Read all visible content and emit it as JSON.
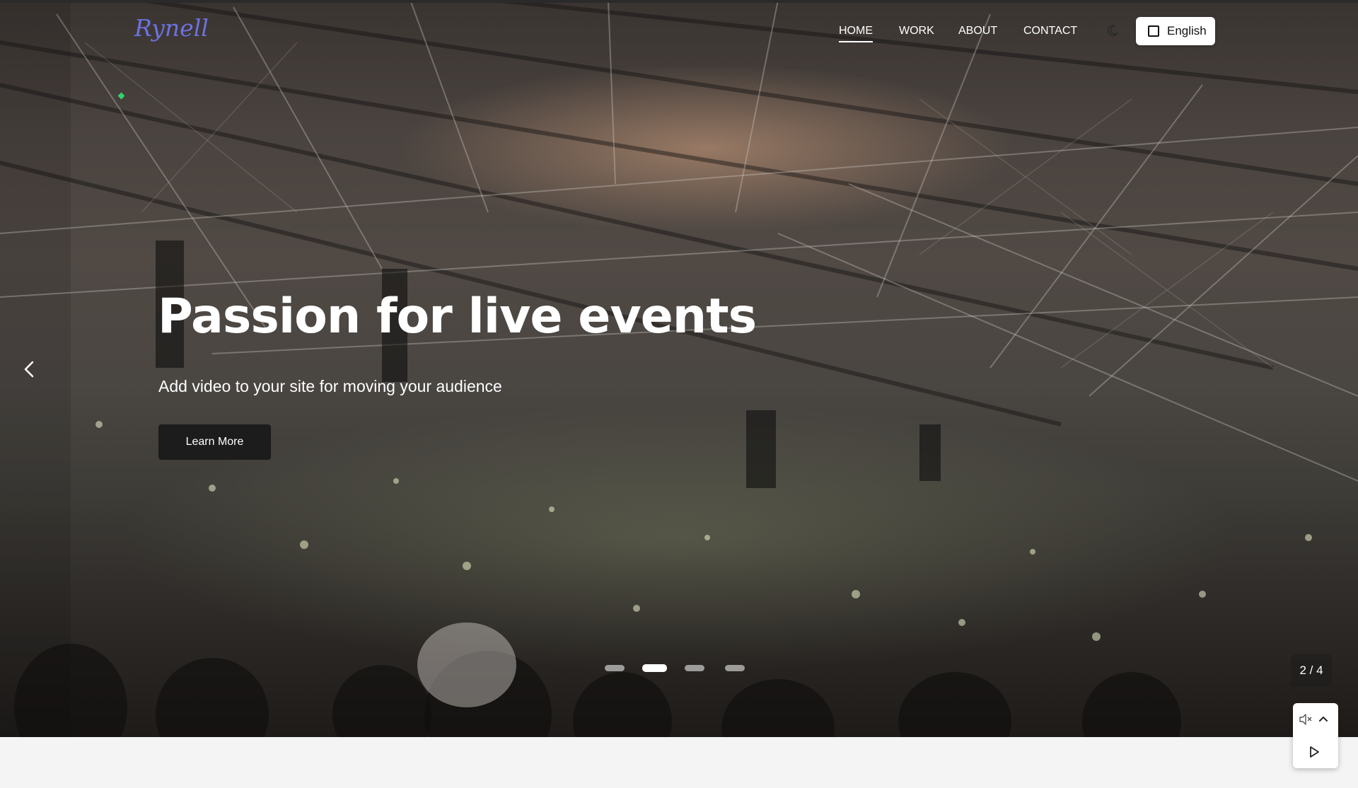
{
  "brand": {
    "logo_text": "Rynell",
    "logo_color": "#6c72e0"
  },
  "nav": {
    "items": [
      {
        "label": "HOME",
        "active": true
      },
      {
        "label": "WORK",
        "active": false
      },
      {
        "label": "ABOUT",
        "active": false
      },
      {
        "label": "CONTACT",
        "active": false
      }
    ],
    "theme_icon": "moon-icon",
    "language_label": "English"
  },
  "hero": {
    "title": "Passion for live events",
    "subtitle": "Add video to your site for moving your audience",
    "cta_label": "Learn More"
  },
  "slider": {
    "current": 2,
    "total": 4,
    "counter_text": "2 / 4",
    "prev_icon": "chevron-left-icon"
  },
  "media_controls": {
    "mute_icon": "speaker-muted-icon",
    "expand_icon": "chevron-up-icon",
    "play_icon": "play-icon"
  },
  "colors": {
    "cta_bg": "#1c1c1c",
    "page_bg": "#f4f4f4"
  }
}
